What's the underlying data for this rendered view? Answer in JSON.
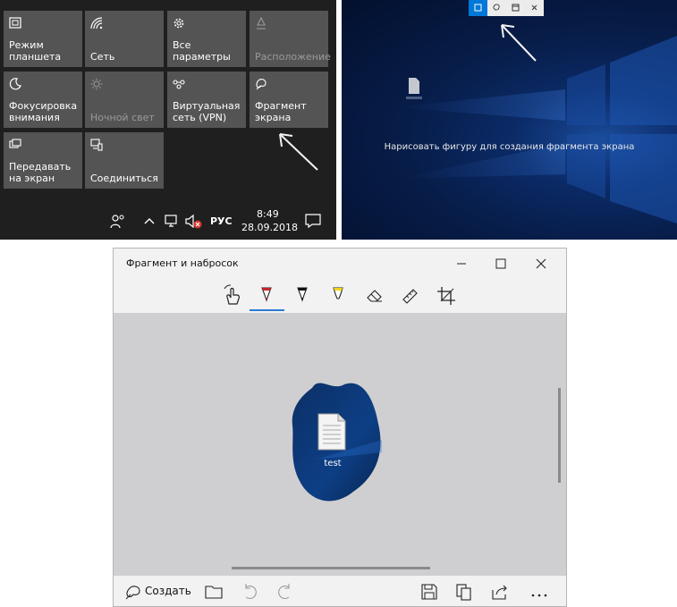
{
  "action_center": {
    "tiles": [
      {
        "icon": "tablet-mode-icon",
        "label": "Режим планшета"
      },
      {
        "icon": "network-icon",
        "label": "Сеть"
      },
      {
        "icon": "gear-icon",
        "label": "Все параметры"
      },
      {
        "icon": "location-icon",
        "label": "Расположение"
      },
      {
        "icon": "focus-assist-icon",
        "label": "Фокусировка внимания"
      },
      {
        "icon": "night-light-icon",
        "label": "Ночной свет"
      },
      {
        "icon": "vpn-icon",
        "label": "Виртуальная сеть (VPN)"
      },
      {
        "icon": "screen-snip-icon",
        "label": "Фрагмент экрана"
      },
      {
        "icon": "project-icon",
        "label": "Передавать на экран"
      },
      {
        "icon": "connect-icon",
        "label": "Соединиться"
      }
    ],
    "taskbar": {
      "language": "РУС",
      "time": "8:49",
      "date": "28.09.2018"
    }
  },
  "desktop": {
    "hint": "Нарисовать фигуру для создания фрагмента экрана",
    "snip_toolbar": [
      "rectangular-snip-icon",
      "freeform-snip-icon",
      "window-snip-icon",
      "close-icon"
    ]
  },
  "app": {
    "title": "Фрагмент и набросок",
    "tools": [
      "touch-writing-icon",
      "ballpoint-pen-icon",
      "pencil-icon",
      "highlighter-icon",
      "eraser-icon",
      "ruler-icon",
      "crop-icon"
    ],
    "canvas": {
      "file_name": "test"
    },
    "bottom": {
      "create_label": "Создать"
    }
  },
  "colors": {
    "tile_bg": "#545454",
    "panel_bg": "#1f1f1f",
    "accent": "#0078d7",
    "active_tool": "#2b7cd3"
  }
}
